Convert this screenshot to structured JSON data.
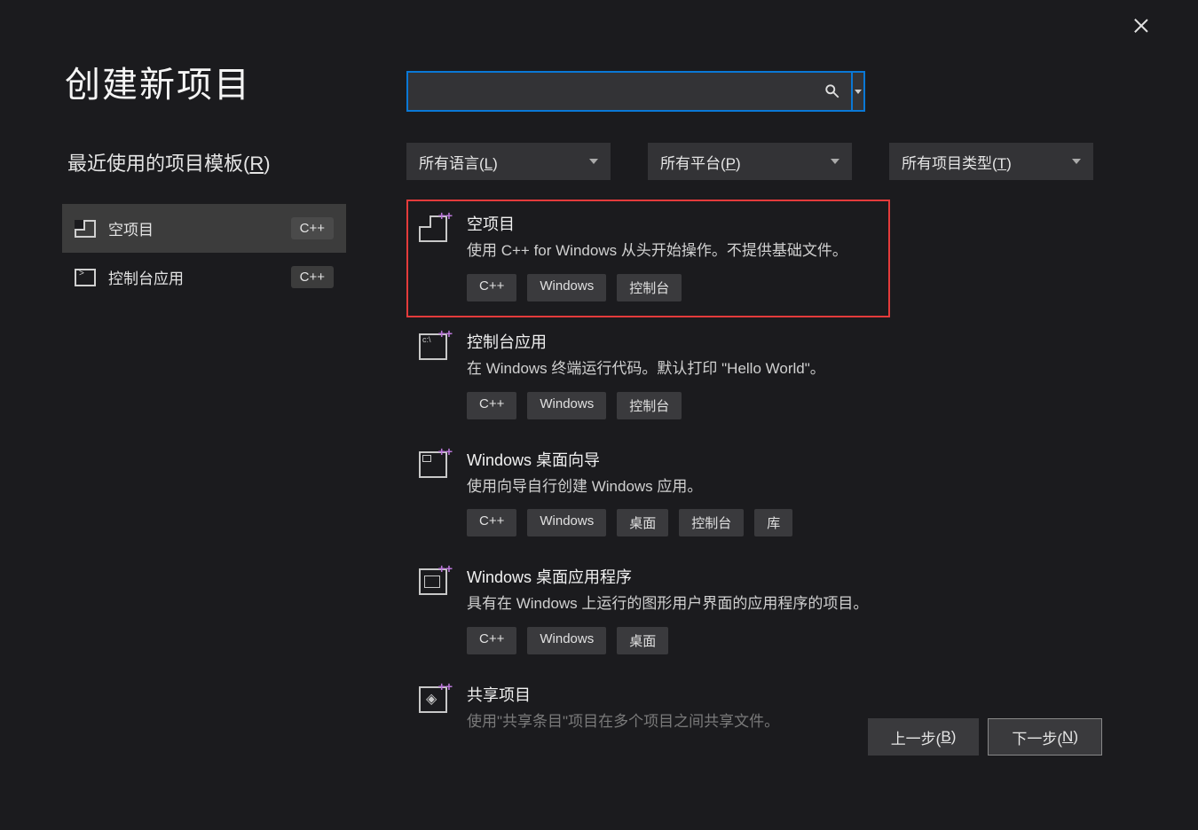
{
  "window": {
    "title": "创建新项目"
  },
  "recent": {
    "label_prefix": "最近使用的项目模板(",
    "label_key": "R",
    "label_suffix": ")",
    "items": [
      {
        "name": "空项目",
        "lang": "C++",
        "icon": "empty",
        "selected": true
      },
      {
        "name": "控制台应用",
        "lang": "C++",
        "icon": "console",
        "selected": false
      }
    ]
  },
  "search": {
    "placeholder": ""
  },
  "filters": [
    {
      "label_prefix": "所有语言(",
      "label_key": "L",
      "label_suffix": ")"
    },
    {
      "label_prefix": "所有平台(",
      "label_key": "P",
      "label_suffix": ")"
    },
    {
      "label_prefix": "所有项目类型(",
      "label_key": "T",
      "label_suffix": ")"
    }
  ],
  "templates": [
    {
      "title": "空项目",
      "desc": "使用 C++ for Windows 从头开始操作。不提供基础文件。",
      "tags": [
        "C++",
        "Windows",
        "控制台"
      ],
      "icon": "folded",
      "selected": true
    },
    {
      "title": "控制台应用",
      "desc": "在 Windows 终端运行代码。默认打印 \"Hello World\"。",
      "tags": [
        "C++",
        "Windows",
        "控制台"
      ],
      "icon": "cmd"
    },
    {
      "title": "Windows 桌面向导",
      "desc": "使用向导自行创建 Windows 应用。",
      "tags": [
        "C++",
        "Windows",
        "桌面",
        "控制台",
        "库"
      ],
      "icon": "wizard"
    },
    {
      "title": "Windows 桌面应用程序",
      "desc": "具有在 Windows 上运行的图形用户界面的应用程序的项目。",
      "tags": [
        "C++",
        "Windows",
        "桌面"
      ],
      "icon": "winapp"
    },
    {
      "title": "共享项目",
      "desc": "使用\"共享条目\"项目在多个项目之间共享文件。",
      "tags": [],
      "icon": "share",
      "faded": true
    }
  ],
  "buttons": {
    "back_prefix": "上一步(",
    "back_key": "B",
    "back_suffix": ")",
    "next_prefix": "下一步(",
    "next_key": "N",
    "next_suffix": ")"
  }
}
